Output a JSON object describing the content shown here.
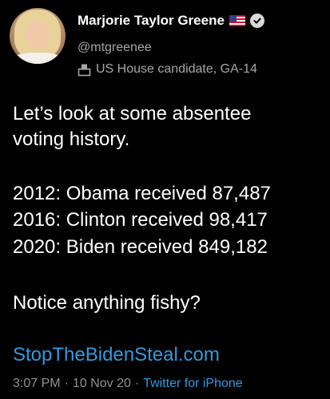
{
  "author": {
    "display_name": "Marjorie Taylor Greene",
    "handle": "@mtgreenee",
    "label": "US House candidate, GA-14",
    "flag_icon": "us-flag-icon",
    "verified_icon": "verified-badge-icon",
    "label_icon": "ballot-box-icon"
  },
  "tweet": {
    "line1": "Let’s look at some absentee",
    "line2": "voting history.",
    "stat1": "2012: Obama received 87,487",
    "stat2": "2016: Clinton received 98,417",
    "stat3": "2020: Biden received 849,182",
    "question": "Notice anything fishy?",
    "link": "StopTheBidenSteal.com"
  },
  "meta": {
    "time": "3:07 PM",
    "date": "10 Nov 20",
    "separator": "·",
    "source": "Twitter for iPhone"
  },
  "colors": {
    "background": "#000000",
    "text": "#ffffff",
    "secondary": "#a4a7aa",
    "link": "#2f9bde"
  }
}
